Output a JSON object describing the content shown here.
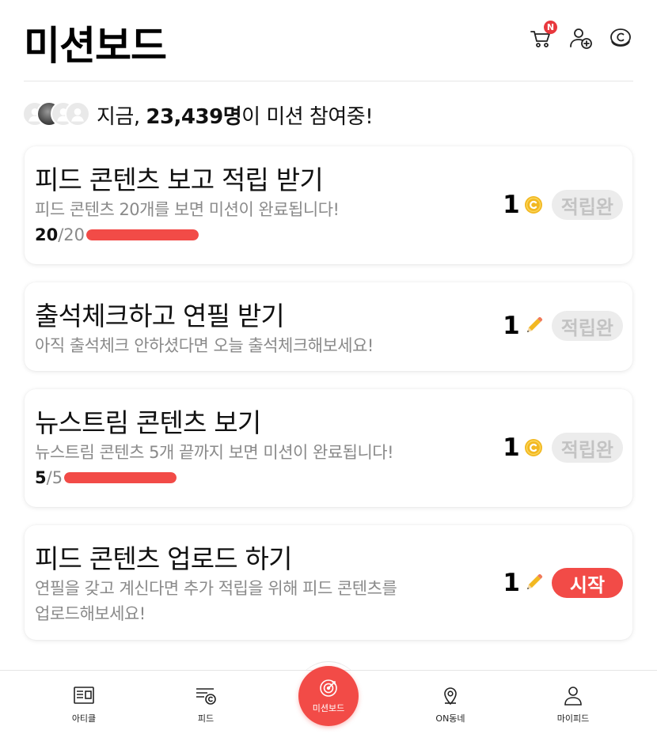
{
  "header": {
    "title": "미션보드",
    "cart_badge": "N",
    "icons": [
      "cart-icon",
      "add-friend-icon",
      "coin-icon"
    ]
  },
  "participants": {
    "prefix": "지금, ",
    "count": "23,439명",
    "suffix": "이 미션 참여중!"
  },
  "missions": [
    {
      "title": "피드 콘텐츠 보고 적립 받기",
      "description": "피드 콘텐츠 20개를 보면 미션이 완료됩니다!",
      "progress_current": "20",
      "progress_total": "/20",
      "progress_fraction": 1.0,
      "reward_amount": "1",
      "reward_icon": "coin-icon",
      "status": "적립완"
    },
    {
      "title": "출석체크하고 연필 받기",
      "description": "아직 출석체크 안하셨다면 오늘 출석체크해보세요!",
      "reward_amount": "1",
      "reward_icon": "pencil-icon",
      "status": "적립완"
    },
    {
      "title": "뉴스트림 콘텐츠 보기",
      "description": "뉴스트림 콘텐츠 5개 끝까지 보면 미션이 완료됩니다!",
      "progress_current": "5",
      "progress_total": "/5",
      "progress_fraction": 1.0,
      "reward_amount": "1",
      "reward_icon": "coin-icon",
      "status": "적립완"
    },
    {
      "title": "피드 콘텐츠 업로드 하기",
      "description_line1": "연필을 갖고 계신다면 추가 적립을 위해 피드 콘텐츠를",
      "description_line2": "업로드해보세요!",
      "reward_amount": "1",
      "reward_icon": "pencil-icon",
      "status": "시작"
    }
  ],
  "nav": {
    "article": "아티클",
    "feed": "피드",
    "missionboard": "미션보드",
    "on_neighborhood": "ON동네",
    "my_feed": "마이피드"
  },
  "colors": {
    "accent": "#f24b47",
    "done_bg": "#ececec",
    "done_text": "#c3c3c3",
    "coin": "#f2b821"
  }
}
